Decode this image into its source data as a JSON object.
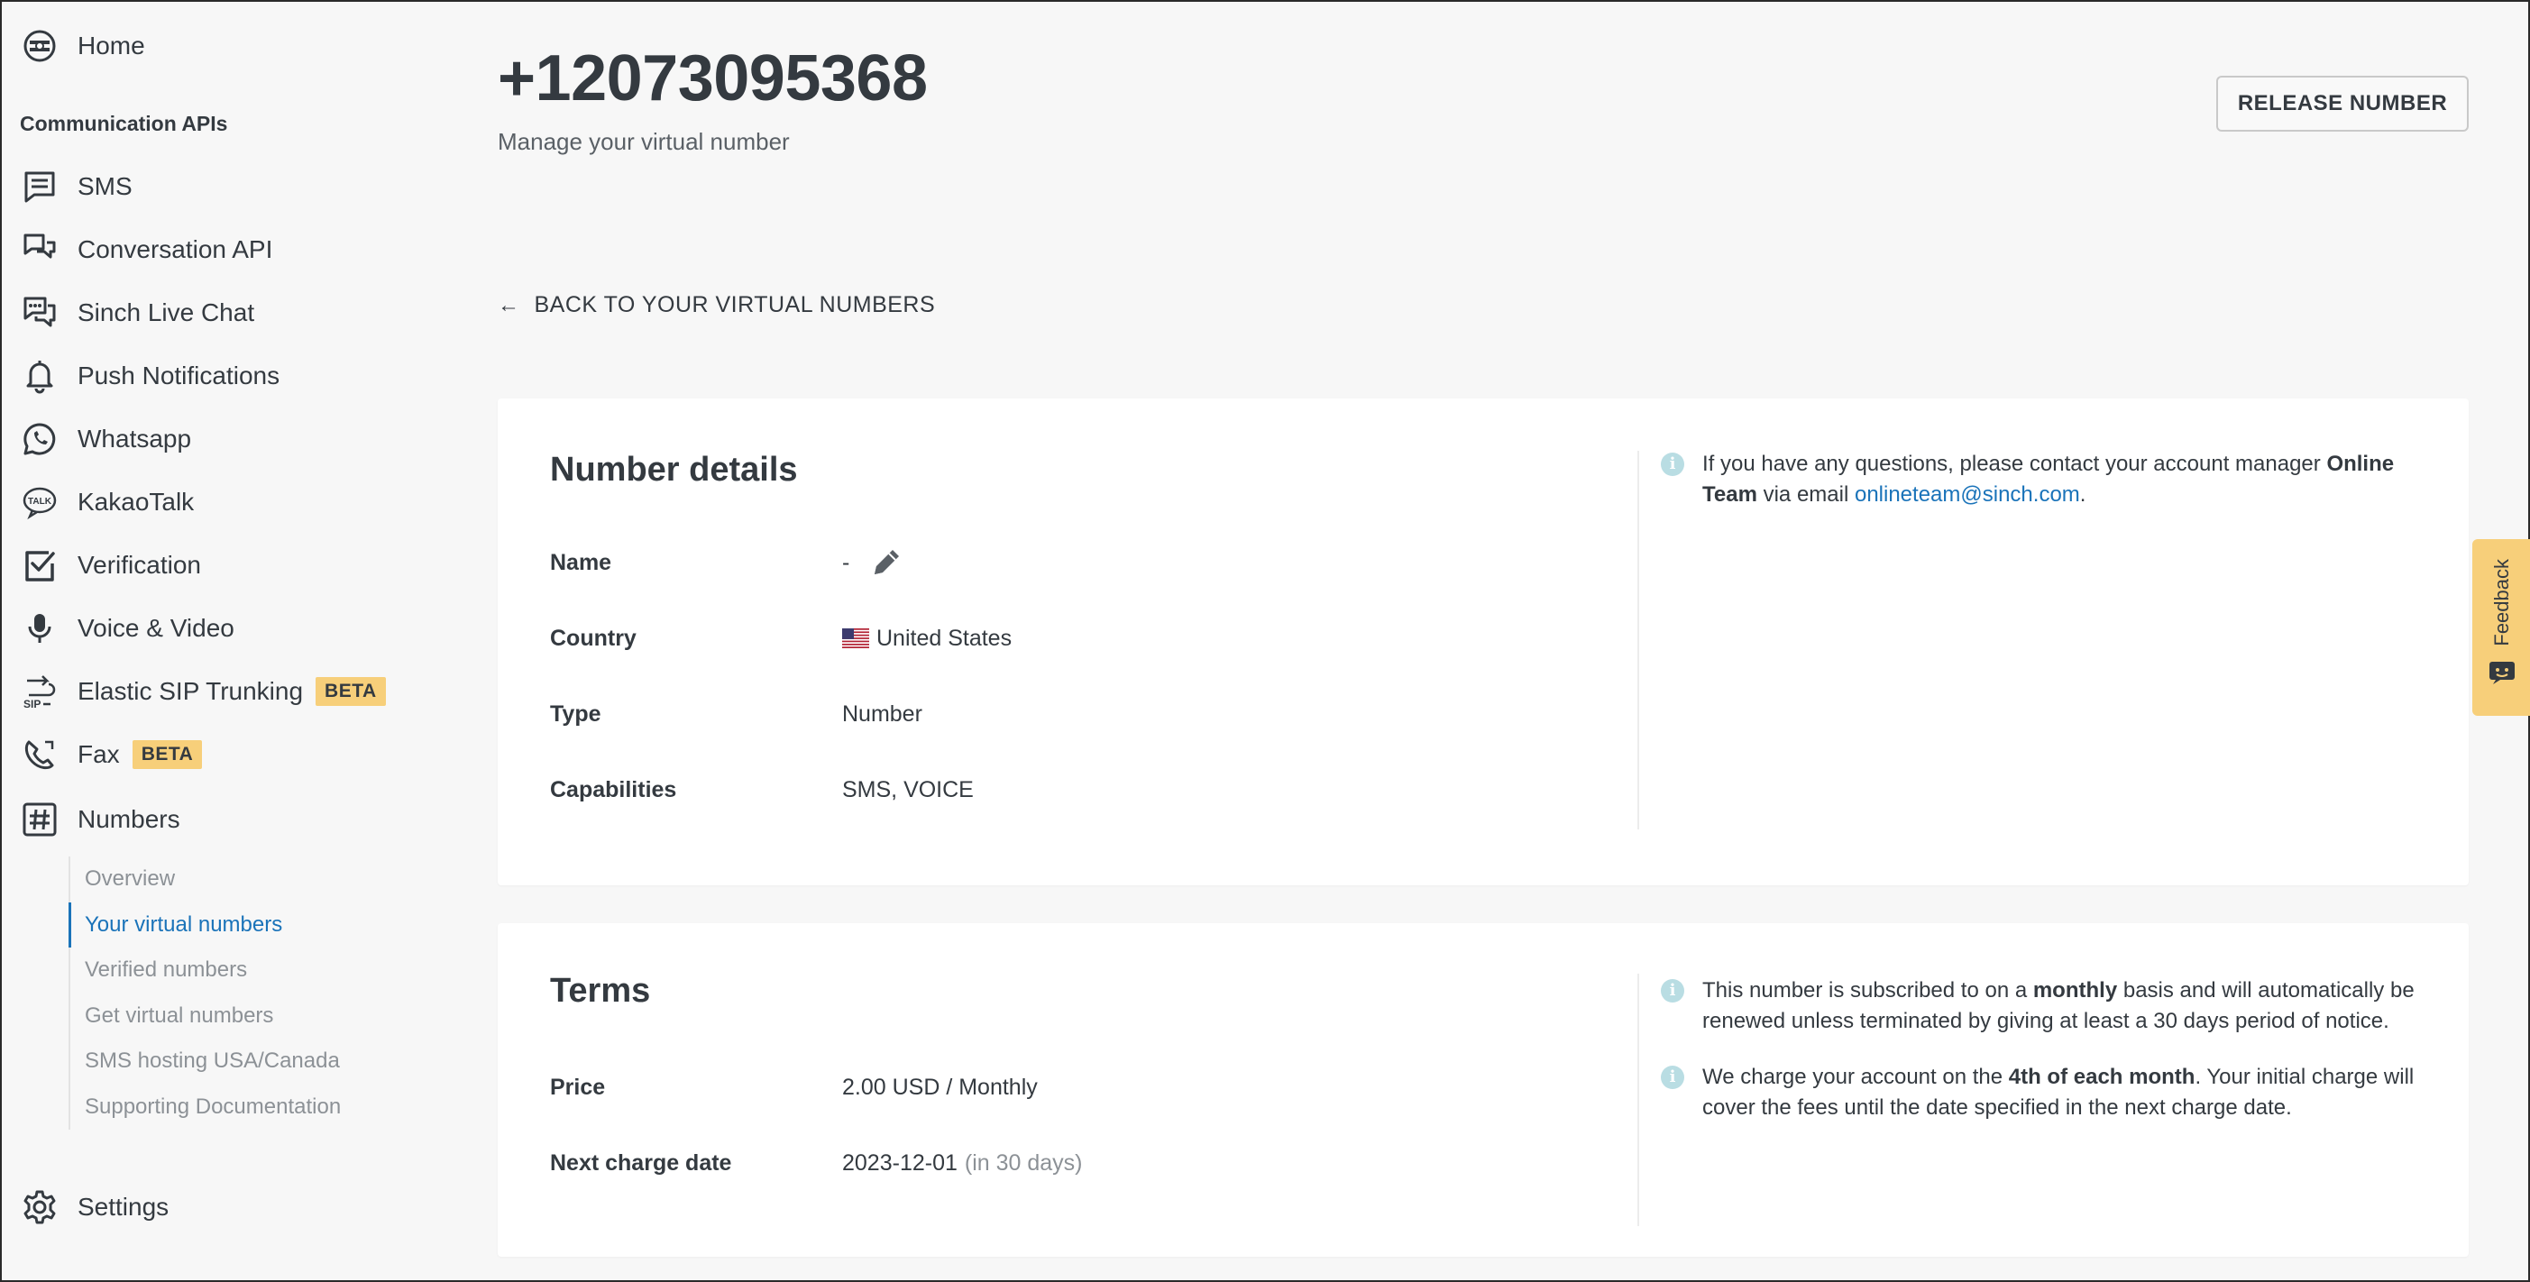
{
  "sidebar": {
    "home": "Home",
    "section_title": "Communication APIs",
    "items": [
      {
        "label": "SMS",
        "icon": "sms-icon"
      },
      {
        "label": "Conversation API",
        "icon": "conversation-icon"
      },
      {
        "label": "Sinch Live Chat",
        "icon": "live-chat-icon"
      },
      {
        "label": "Push Notifications",
        "icon": "bell-icon"
      },
      {
        "label": "Whatsapp",
        "icon": "whatsapp-icon"
      },
      {
        "label": "KakaoTalk",
        "icon": "kakaotalk-icon"
      },
      {
        "label": "Verification",
        "icon": "verification-icon"
      },
      {
        "label": "Voice & Video",
        "icon": "microphone-icon"
      },
      {
        "label": "Elastic SIP Trunking",
        "icon": "sip-icon",
        "badge": "BETA"
      },
      {
        "label": "Fax",
        "icon": "fax-icon",
        "badge": "BETA"
      },
      {
        "label": "Numbers",
        "icon": "hash-icon"
      }
    ],
    "numbers_subnav": [
      "Overview",
      "Your virtual numbers",
      "Verified numbers",
      "Get virtual numbers",
      "SMS hosting USA/Canada",
      "Supporting Documentation"
    ],
    "active_subnav": "Your virtual numbers",
    "settings": "Settings"
  },
  "header": {
    "title": "+12073095368",
    "subtitle": "Manage your virtual number",
    "release_button": "RELEASE NUMBER"
  },
  "back_link": "BACK TO YOUR VIRTUAL NUMBERS",
  "number_details": {
    "title": "Number details",
    "rows": [
      {
        "label": "Name",
        "value": "-"
      },
      {
        "label": "Country",
        "value": "United States"
      },
      {
        "label": "Type",
        "value": "Number"
      },
      {
        "label": "Capabilities",
        "value": "SMS, VOICE"
      }
    ],
    "info": {
      "text_before": "If you have any questions, please contact your account manager ",
      "manager": "Online Team",
      "text_middle": " via email ",
      "email": "onlineteam@sinch.com",
      "text_after": "."
    }
  },
  "terms": {
    "title": "Terms",
    "rows": [
      {
        "label": "Price",
        "value": "2.00 USD / Monthly"
      },
      {
        "label": "Next charge date",
        "value": "2023-12-01",
        "note": "(in 30 days)"
      }
    ],
    "info1": {
      "before": "This number is subscribed to on a ",
      "bold": "monthly",
      "after": " basis and will automatically be renewed unless terminated by giving at least a 30 days period of notice."
    },
    "info2": {
      "before": "We charge your account on the ",
      "bold": "4th of each month",
      "after": ". Your initial charge will cover the fees until the date specified in the next charge date."
    }
  },
  "feedback": "Feedback",
  "colors": {
    "accent": "#1a73b9",
    "badge": "#f7cf7a",
    "text": "#343a40",
    "background": "#f7f7f7"
  }
}
